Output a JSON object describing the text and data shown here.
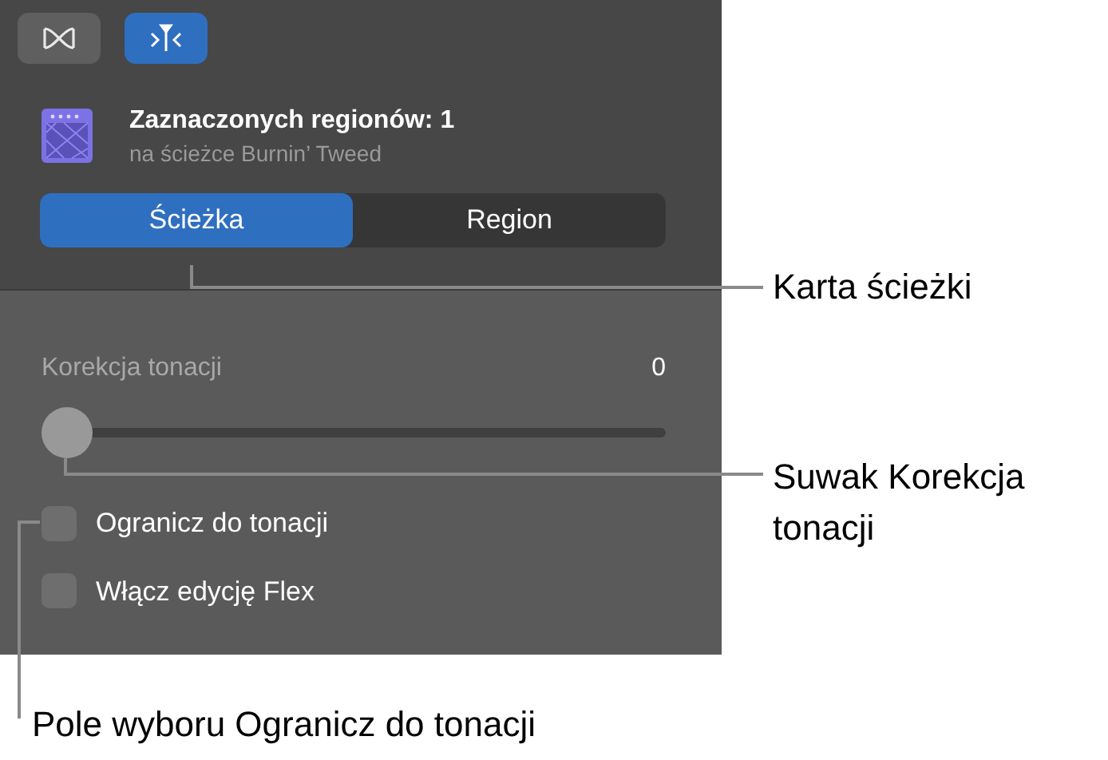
{
  "toolbar": [
    {
      "kind": "flex",
      "selected": false
    },
    {
      "kind": "pitch",
      "selected": true
    }
  ],
  "header": {
    "title": "Zaznaczonych regionów: 1",
    "subtitle": "na ścieżce Burnin’ Tweed"
  },
  "tabs": [
    {
      "label": "Ścieżka",
      "selected": true
    },
    {
      "label": "Region",
      "selected": false
    }
  ],
  "slider": {
    "label": "Korekcja tonacji",
    "reading": "0",
    "level": 0
  },
  "checkboxes": [
    {
      "label": "Ogranicz do tonacji",
      "checked": false
    },
    {
      "label": "Włącz edycję Flex",
      "checked": false
    }
  ],
  "callouts": [
    "Karta ścieżki",
    "Suwak Korekcja tonacji",
    "Pole wyboru Ogranicz do tonacji"
  ]
}
